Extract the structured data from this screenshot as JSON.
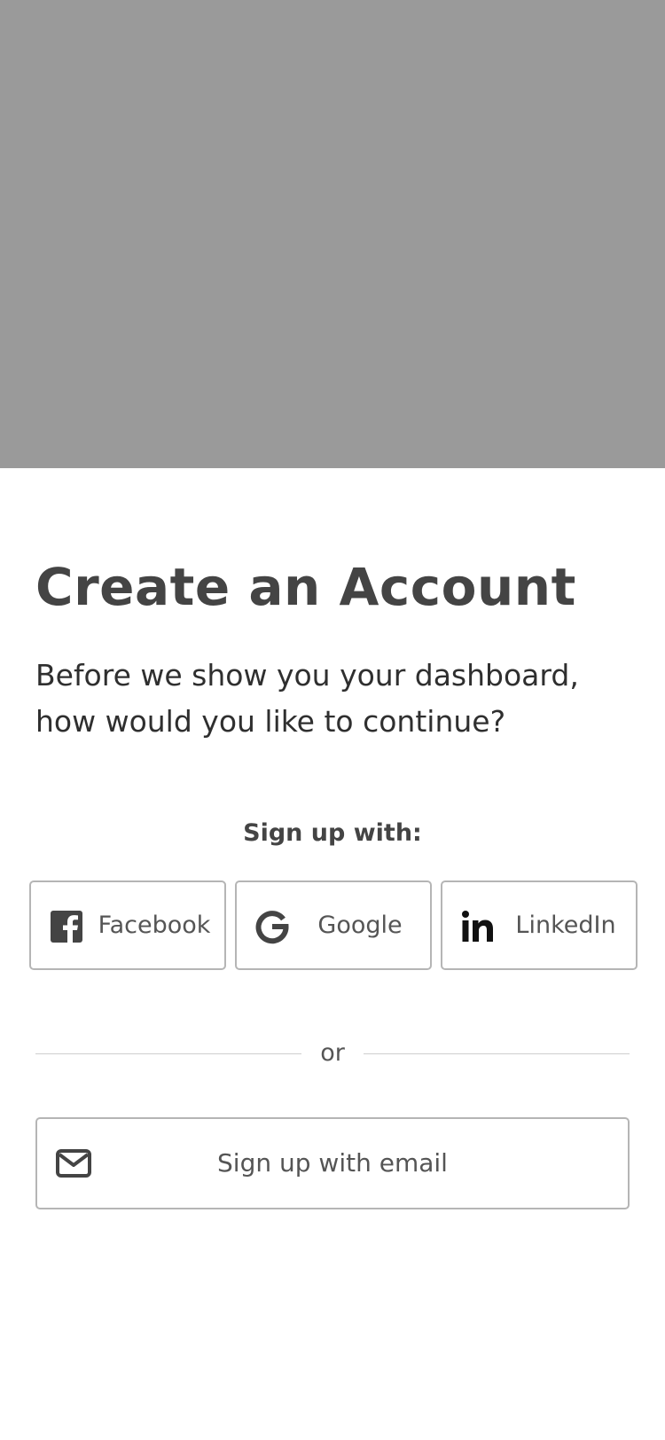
{
  "hero": {
    "background_color": "#9a9a9a"
  },
  "page": {
    "title": "Create an Account",
    "subtitle_line1": "Before we show you your dashboard,",
    "subtitle_line2": "how would you like to continue?"
  },
  "social": {
    "heading": "Sign up with:",
    "buttons": [
      {
        "label": "Facebook",
        "icon": "facebook-icon"
      },
      {
        "label": "Google",
        "icon": "google-icon"
      },
      {
        "label": "LinkedIn",
        "icon": "linkedin-icon"
      }
    ]
  },
  "divider": {
    "text": "or"
  },
  "email": {
    "label": "Sign up with email",
    "icon": "envelope-icon"
  },
  "colors": {
    "text_primary": "#444444",
    "border": "#b5b5b5",
    "divider": "#cfcfcf"
  }
}
